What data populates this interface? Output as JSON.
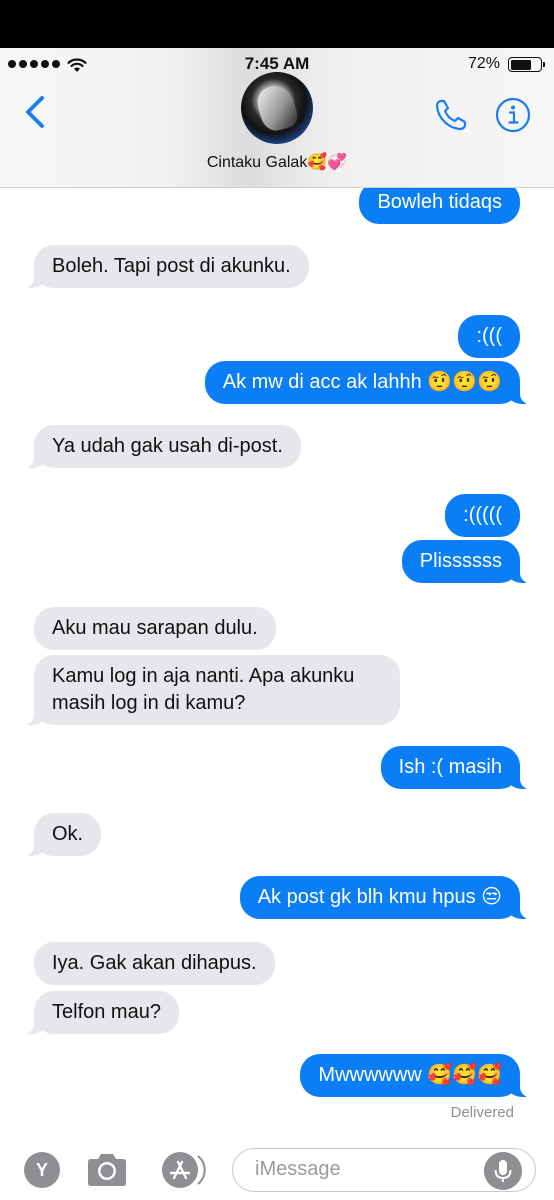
{
  "status": {
    "time": "7:45 AM",
    "battery": "72%",
    "battery_level": 0.72
  },
  "header": {
    "contact_name": "Cintaku Galak🥰💞",
    "back_icon": "chevron-left-icon",
    "call_icon": "phone-icon",
    "info_icon": "info-icon"
  },
  "messages": [
    {
      "dir": "out",
      "text": "Bowleh tidaqs"
    },
    {
      "dir": "in",
      "text": "Boleh. Tapi post di akunku."
    },
    {
      "dir": "out",
      "text": ":((("
    },
    {
      "dir": "out",
      "text": "Ak mw di acc ak lahhh 🤨🤨🤨"
    },
    {
      "dir": "in",
      "text": "Ya udah gak usah di-post."
    },
    {
      "dir": "out",
      "text": ":((((("
    },
    {
      "dir": "out",
      "text": "Plissssss"
    },
    {
      "dir": "in",
      "text": "Aku mau sarapan dulu."
    },
    {
      "dir": "in",
      "text": "Kamu log in aja nanti. Apa akunku masih log in di kamu?"
    },
    {
      "dir": "out",
      "text": "Ish :( masih"
    },
    {
      "dir": "in",
      "text": "Ok."
    },
    {
      "dir": "out",
      "text": "Ak post gk blh kmu hpus 😒"
    },
    {
      "dir": "in",
      "text": "Iya. Gak akan dihapus."
    },
    {
      "dir": "in",
      "text": "Telfon mau?"
    },
    {
      "dir": "out",
      "text": "Mwwwwww 🥰🥰🥰"
    }
  ],
  "delivered": "Delivered",
  "composer": {
    "app_icon_label": "Y",
    "placeholder": "iMessage"
  },
  "colors": {
    "outgoing": "#0b7ef6",
    "incoming": "#e6e6eb",
    "accent": "#1a7ef2"
  }
}
